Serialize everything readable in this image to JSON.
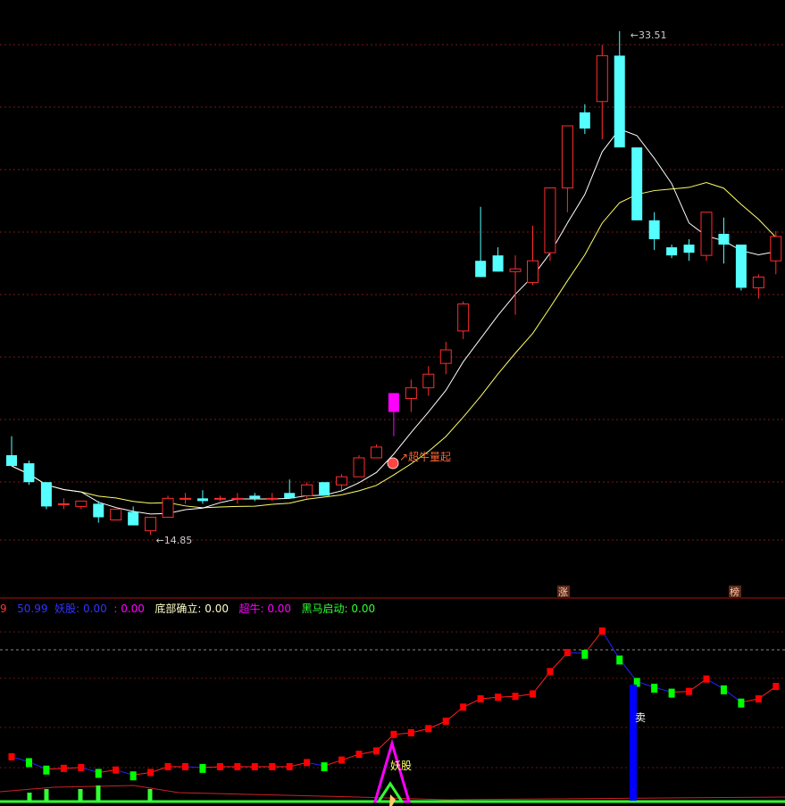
{
  "main_chart": {
    "high_label": "33.51",
    "low_label": "14.85",
    "signal_label": "超牛量起",
    "badge_zhang": "涨",
    "badge_bang": "榜"
  },
  "indicator_header": {
    "prefix": "9",
    "v1": "50.99",
    "yaogu_label": "妖股:",
    "yaogu_value": "0.00",
    "sep_value": "0.00",
    "dibu_label": "底部确立:",
    "dibu_value": "0.00",
    "chaoniu_label": "超牛:",
    "chaoniu_value": "0.00",
    "heima_label": "黑马启动:",
    "heima_value": "0.00"
  },
  "indicator_chart": {
    "yaogu_text": "妖股",
    "sell_text": "卖"
  },
  "colors": {
    "up": "#ff2d2d",
    "down": "#55ffff",
    "signal_up": "#ff00ff",
    "ma_short": "#ffffff",
    "ma_long": "#ffff66",
    "ind_up": "#ff0000",
    "ind_down": "#00ff00",
    "sell": "#0000ff"
  },
  "chart_data": [
    {
      "type": "candlestick",
      "ylim": [
        13.5,
        34.0
      ],
      "series": [
        {
          "name": "",
          "candles": [
            {
              "o": 17.8,
              "h": 18.5,
              "l": 17.4,
              "c": 17.4
            },
            {
              "o": 17.5,
              "h": 17.6,
              "l": 16.7,
              "c": 16.8
            },
            {
              "o": 16.8,
              "h": 16.8,
              "l": 15.8,
              "c": 15.9
            },
            {
              "o": 16.0,
              "h": 16.2,
              "l": 15.8,
              "c": 16.0
            },
            {
              "o": 15.9,
              "h": 16.1,
              "l": 15.8,
              "c": 16.1
            },
            {
              "o": 16.0,
              "h": 16.1,
              "l": 15.3,
              "c": 15.5
            },
            {
              "o": 15.4,
              "h": 15.8,
              "l": 15.4,
              "c": 15.8
            },
            {
              "o": 15.7,
              "h": 15.9,
              "l": 15.2,
              "c": 15.2
            },
            {
              "o": 15.0,
              "h": 15.5,
              "l": 14.85,
              "c": 15.5
            },
            {
              "o": 15.5,
              "h": 16.3,
              "l": 15.5,
              "c": 16.2
            },
            {
              "o": 16.2,
              "h": 16.4,
              "l": 16.0,
              "c": 16.2
            },
            {
              "o": 16.2,
              "h": 16.5,
              "l": 16.0,
              "c": 16.1
            },
            {
              "o": 16.2,
              "h": 16.3,
              "l": 16.1,
              "c": 16.2
            },
            {
              "o": 16.2,
              "h": 16.4,
              "l": 16.0,
              "c": 16.2
            },
            {
              "o": 16.3,
              "h": 16.4,
              "l": 16.1,
              "c": 16.2
            },
            {
              "o": 16.2,
              "h": 16.4,
              "l": 16.1,
              "c": 16.2
            },
            {
              "o": 16.4,
              "h": 16.9,
              "l": 16.2,
              "c": 16.2
            },
            {
              "o": 16.3,
              "h": 16.8,
              "l": 16.2,
              "c": 16.7
            },
            {
              "o": 16.8,
              "h": 16.8,
              "l": 16.3,
              "c": 16.3
            },
            {
              "o": 16.7,
              "h": 17.1,
              "l": 16.5,
              "c": 17.0
            },
            {
              "o": 17.0,
              "h": 17.8,
              "l": 17.0,
              "c": 17.7
            },
            {
              "o": 17.7,
              "h": 18.2,
              "l": 17.7,
              "c": 18.1
            },
            {
              "o": 19.4,
              "h": 20.1,
              "l": 18.5,
              "c": 20.1
            },
            {
              "o": 19.9,
              "h": 20.6,
              "l": 19.4,
              "c": 20.3
            },
            {
              "o": 20.3,
              "h": 21.1,
              "l": 20.0,
              "c": 20.8
            },
            {
              "o": 21.2,
              "h": 22.0,
              "l": 20.8,
              "c": 21.7
            },
            {
              "o": 22.4,
              "h": 23.5,
              "l": 22.1,
              "c": 23.4
            },
            {
              "o": 25.0,
              "h": 27.0,
              "l": 24.7,
              "c": 24.4
            },
            {
              "o": 25.2,
              "h": 25.5,
              "l": 24.6,
              "c": 24.6
            },
            {
              "o": 24.6,
              "h": 25.2,
              "l": 23.0,
              "c": 24.7
            },
            {
              "o": 24.2,
              "h": 26.3,
              "l": 24.1,
              "c": 25.0
            },
            {
              "o": 25.3,
              "h": 27.7,
              "l": 25.0,
              "c": 27.7
            },
            {
              "o": 27.7,
              "h": 29.2,
              "l": 26.8,
              "c": 30.0
            },
            {
              "o": 30.5,
              "h": 30.8,
              "l": 29.7,
              "c": 29.9
            },
            {
              "o": 30.9,
              "h": 33.0,
              "l": 29.5,
              "c": 32.6
            },
            {
              "o": 32.6,
              "h": 33.51,
              "l": 32.3,
              "c": 29.2
            },
            {
              "o": 29.2,
              "h": 29.0,
              "l": 26.7,
              "c": 26.5
            },
            {
              "o": 26.5,
              "h": 26.8,
              "l": 25.4,
              "c": 25.8
            },
            {
              "o": 25.5,
              "h": 25.6,
              "l": 25.1,
              "c": 25.2
            },
            {
              "o": 25.6,
              "h": 25.8,
              "l": 25.0,
              "c": 25.3
            },
            {
              "o": 25.2,
              "h": 26.7,
              "l": 25.0,
              "c": 26.8
            },
            {
              "o": 26.0,
              "h": 26.6,
              "l": 24.9,
              "c": 25.6
            },
            {
              "o": 25.6,
              "h": 25.6,
              "l": 23.9,
              "c": 24.0
            },
            {
              "o": 24.0,
              "h": 24.5,
              "l": 23.6,
              "c": 24.4
            },
            {
              "o": 25.0,
              "h": 26.1,
              "l": 24.5,
              "c": 25.9
            }
          ]
        }
      ]
    }
  ]
}
